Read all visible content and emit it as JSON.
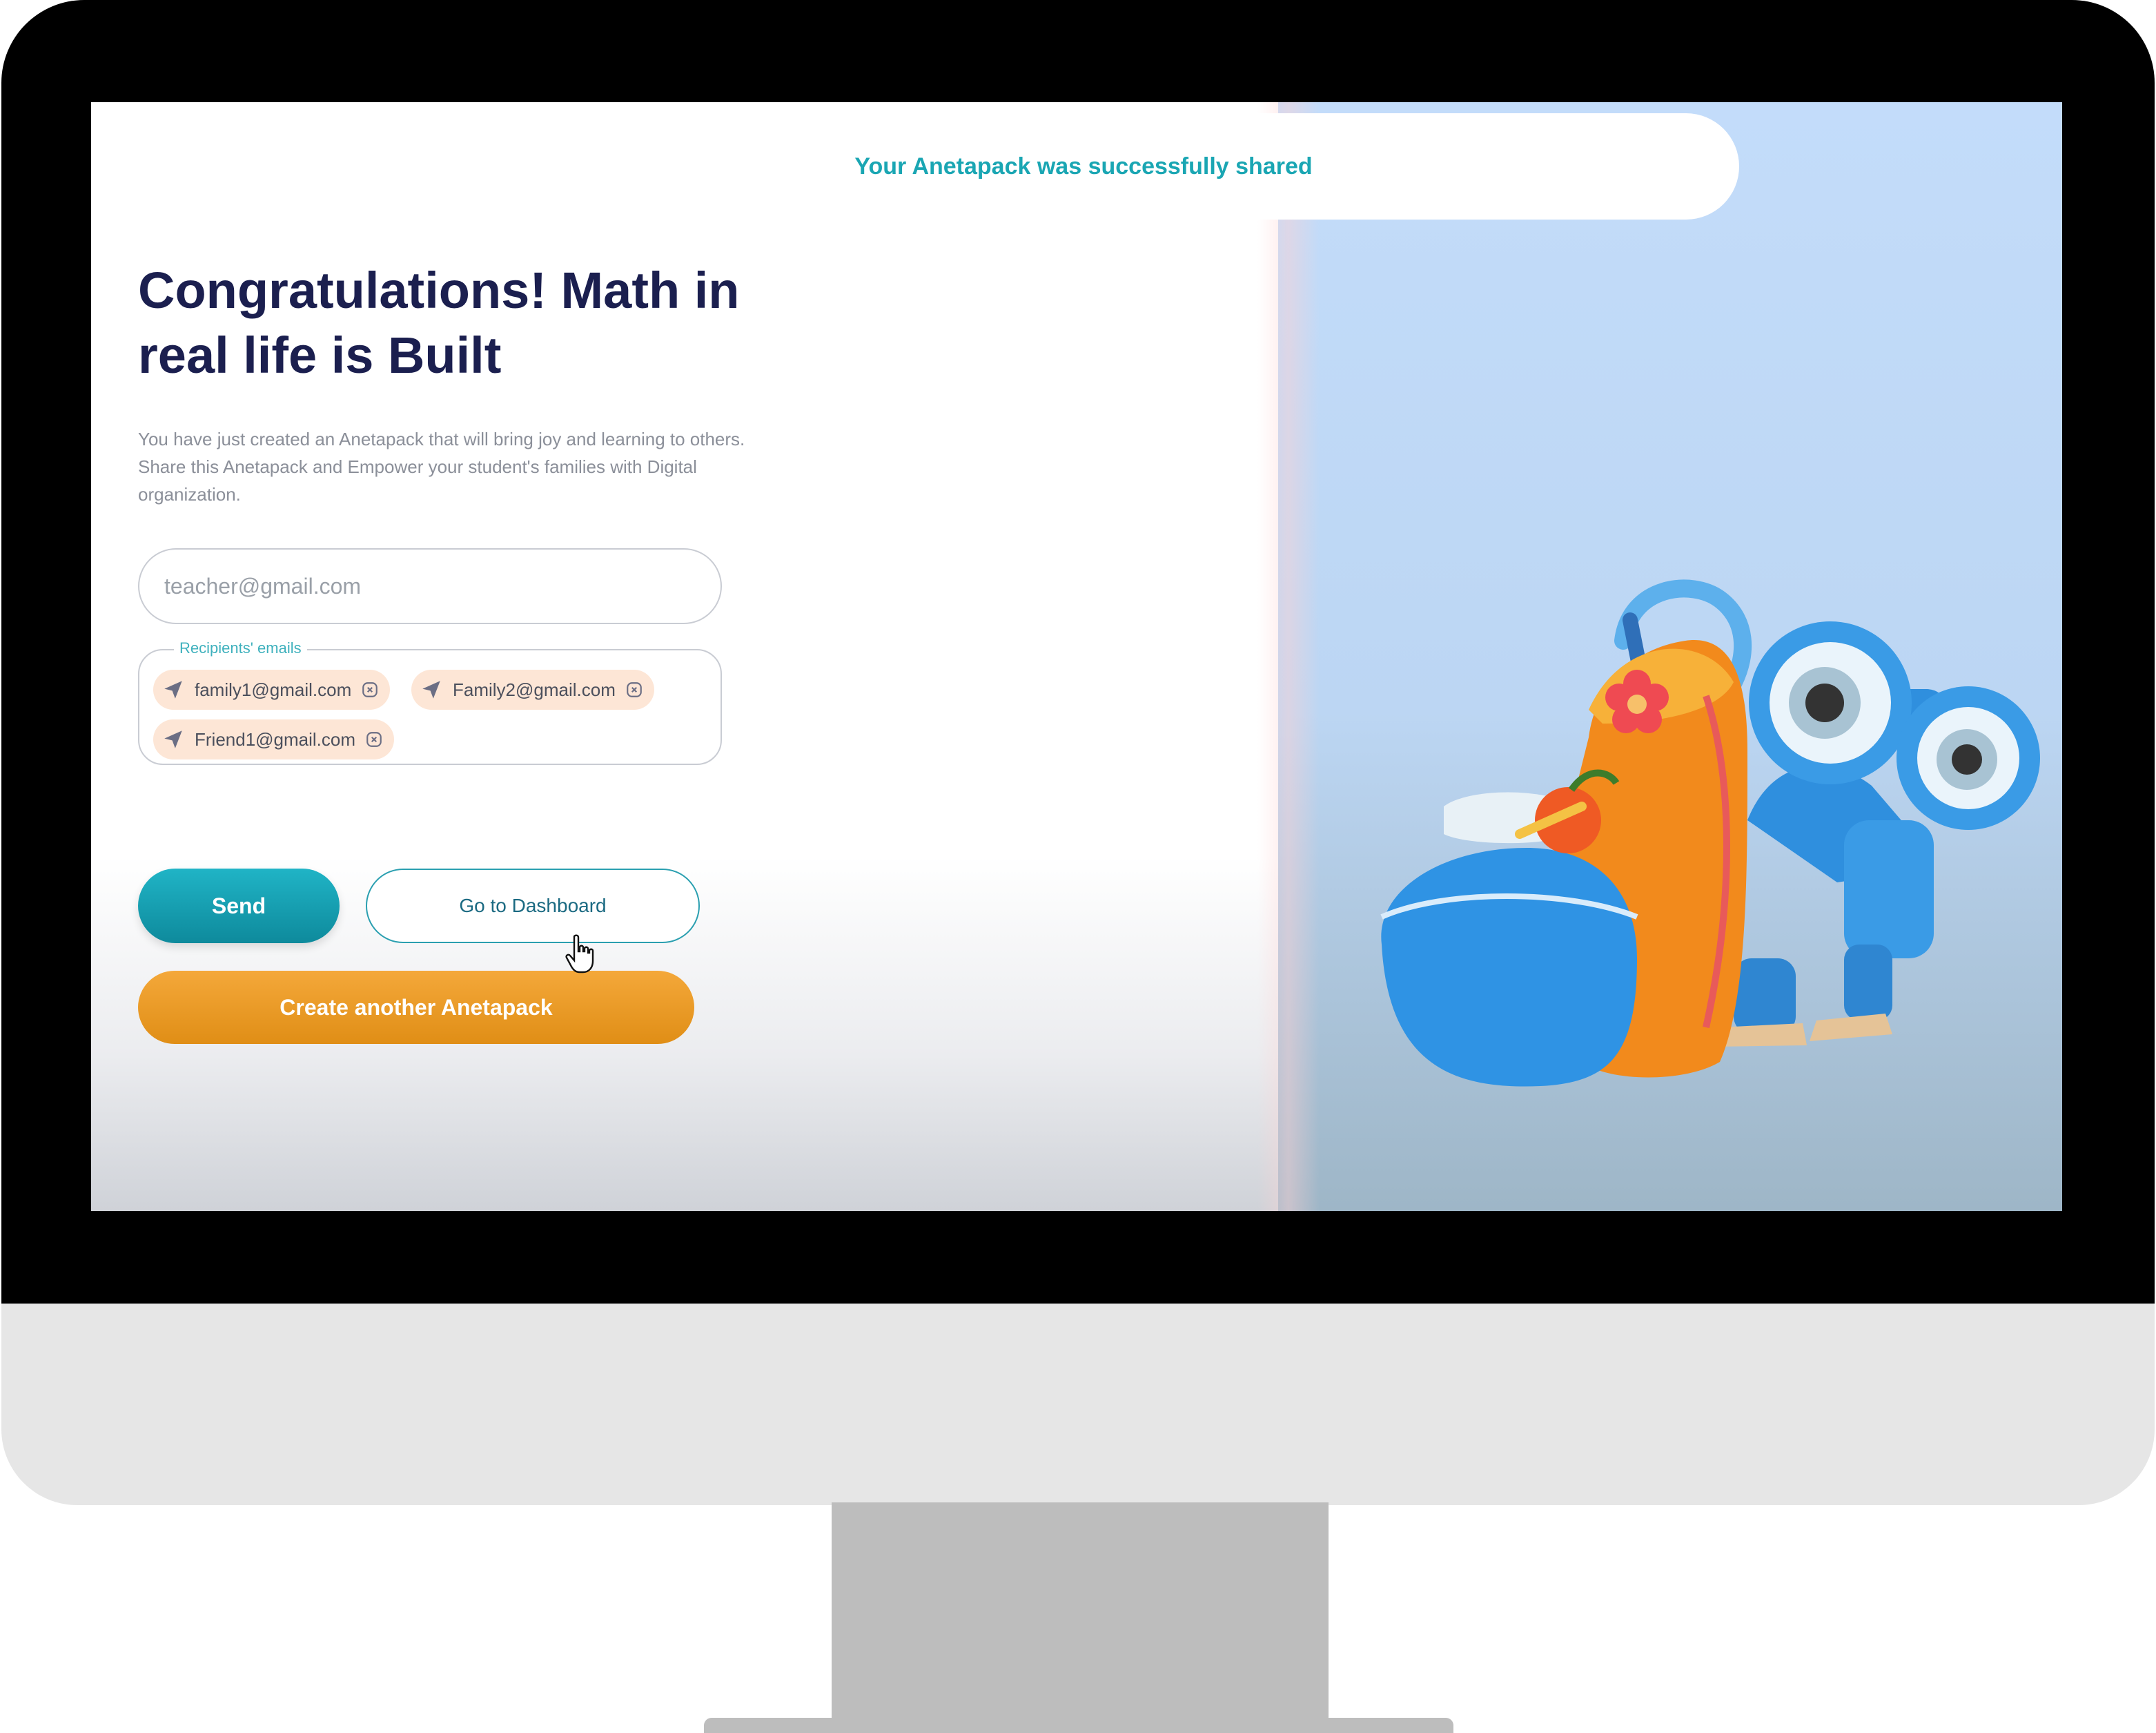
{
  "toast": {
    "message": "Your Anetapack was successfully shared"
  },
  "page": {
    "title": "Congratulations! Math in real life is Built",
    "description": "You have just created an Anetapack that will bring joy and learning to others. Share this Anetapack and Empower your student's families with Digital organization."
  },
  "email_input": {
    "placeholder": "teacher@gmail.com",
    "value": ""
  },
  "recipients": {
    "legend": "Recipients' emails",
    "items": [
      {
        "email": "family1@gmail.com"
      },
      {
        "email": "Family2@gmail.com"
      },
      {
        "email": "Friend1@gmail.com"
      }
    ]
  },
  "buttons": {
    "send": "Send",
    "dashboard": "Go to Dashboard",
    "create": "Create another Anetapack"
  },
  "icons": {
    "chip_icon": "send-icon",
    "remove_icon": "close-icon",
    "cursor": "hand-cursor-icon",
    "illustration": "backpack-robot-illustration"
  },
  "colors": {
    "title": "#1b1f4f",
    "accent_teal": "#1aa6b3",
    "accent_orange": "#f0a030",
    "chip_bg": "#fde6d6"
  }
}
